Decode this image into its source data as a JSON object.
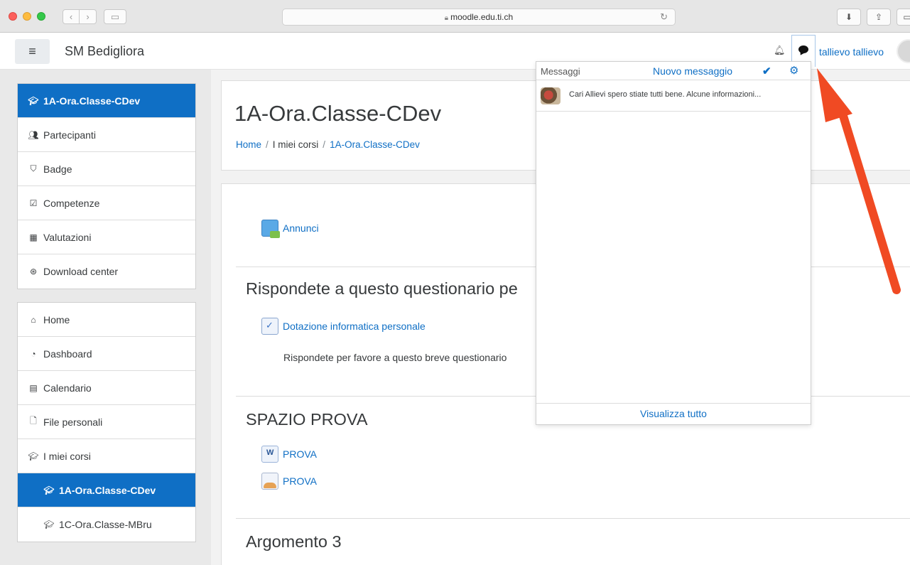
{
  "browser": {
    "url": "moodle.edu.ti.ch"
  },
  "navbar": {
    "site_name": "SM Bedigliora",
    "user_name": "tallievo tallievo"
  },
  "sidebar": {
    "course_items": [
      {
        "label": "1A-Ora.Classe-CDev",
        "icon": "graduation-cap-icon",
        "active": true
      },
      {
        "label": "Partecipanti",
        "icon": "users-icon"
      },
      {
        "label": "Badge",
        "icon": "shield-icon"
      },
      {
        "label": "Competenze",
        "icon": "checkbox-icon"
      },
      {
        "label": "Valutazioni",
        "icon": "table-icon"
      },
      {
        "label": "Download center",
        "icon": "download-icon"
      }
    ],
    "nav_items": [
      {
        "label": "Home",
        "icon": "home-icon"
      },
      {
        "label": "Dashboard",
        "icon": "dashboard-icon"
      },
      {
        "label": "Calendario",
        "icon": "calendar-icon"
      },
      {
        "label": "File personali",
        "icon": "file-icon"
      },
      {
        "label": "I miei corsi",
        "icon": "graduation-cap-icon"
      },
      {
        "label": "1A-Ora.Classe-CDev",
        "icon": "graduation-cap-icon",
        "active": true
      },
      {
        "label": "1C-Ora.Classe-MBru",
        "icon": "graduation-cap-icon"
      }
    ]
  },
  "header": {
    "title": "1A-Ora.Classe-CDev",
    "breadcrumb": [
      "Home",
      "I miei corsi",
      "1A-Ora.Classe-CDev"
    ]
  },
  "content": {
    "announcements": "Annunci",
    "section1_title": "Rispondete a questo questionario pe",
    "questionnaire": "Dotazione informatica personale",
    "questionnaire_summary": "Rispondete per favore a questo breve questionario",
    "section2_title": "SPAZIO PROVA",
    "file1": "PROVA",
    "file2": "PROVA",
    "section3_title": "Argomento 3"
  },
  "messages": {
    "title": "Messaggi",
    "new_message": "Nuovo messaggio",
    "preview": "Cari Allievi spero stiate tutti bene. Alcune informazioni...",
    "view_all": "Visualizza tutto"
  },
  "colors": {
    "brand": "#0f6fc5",
    "arrow": "#f04a23"
  }
}
